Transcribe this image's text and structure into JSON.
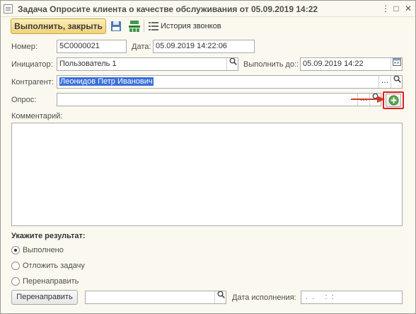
{
  "window": {
    "title": "Задача Опросите клиента о качестве обслуживания от 05.09.2019 14:22",
    "more_btn": "⋮",
    "restore_btn": "□",
    "close_btn": "✕"
  },
  "toolbar": {
    "execute_close_label": "Выполнить, закрыть",
    "call_history_label": "История звонков"
  },
  "form": {
    "number_label": "Номер:",
    "number_value": "5С0000021",
    "date_label": "Дата:",
    "date_value": "05.09.2019 14:22:06",
    "initiator_label": "Инициатор:",
    "initiator_value": "Пользователь 1",
    "due_label": "Выполнить до::",
    "due_value": "05.09.2019 14:22",
    "counterparty_label": "Контрагент:",
    "counterparty_value": "Леонидов Петр Иванович",
    "survey_label": "Опрос:",
    "survey_value": "",
    "comment_label": "Комментарий:",
    "comment_value": ""
  },
  "result": {
    "heading": "Укажите результат:",
    "options": [
      "Выполнено",
      "Отложить задачу",
      "Перенаправить"
    ],
    "selected_index": 0,
    "redirect_button": "Перенаправить",
    "redirect_value": "",
    "exec_date_label": "Дата исполнения:",
    "exec_date_value": " .  .     :  :"
  },
  "colors": {
    "highlight_border": "#e02020",
    "arrow": "#d23a2a",
    "selection_bg": "#3a6fd8",
    "primary_button": "#f1d27a"
  },
  "icons": {
    "ellipsis": "…",
    "search": "search-icon",
    "calendar": "calendar-icon",
    "add": "+"
  }
}
